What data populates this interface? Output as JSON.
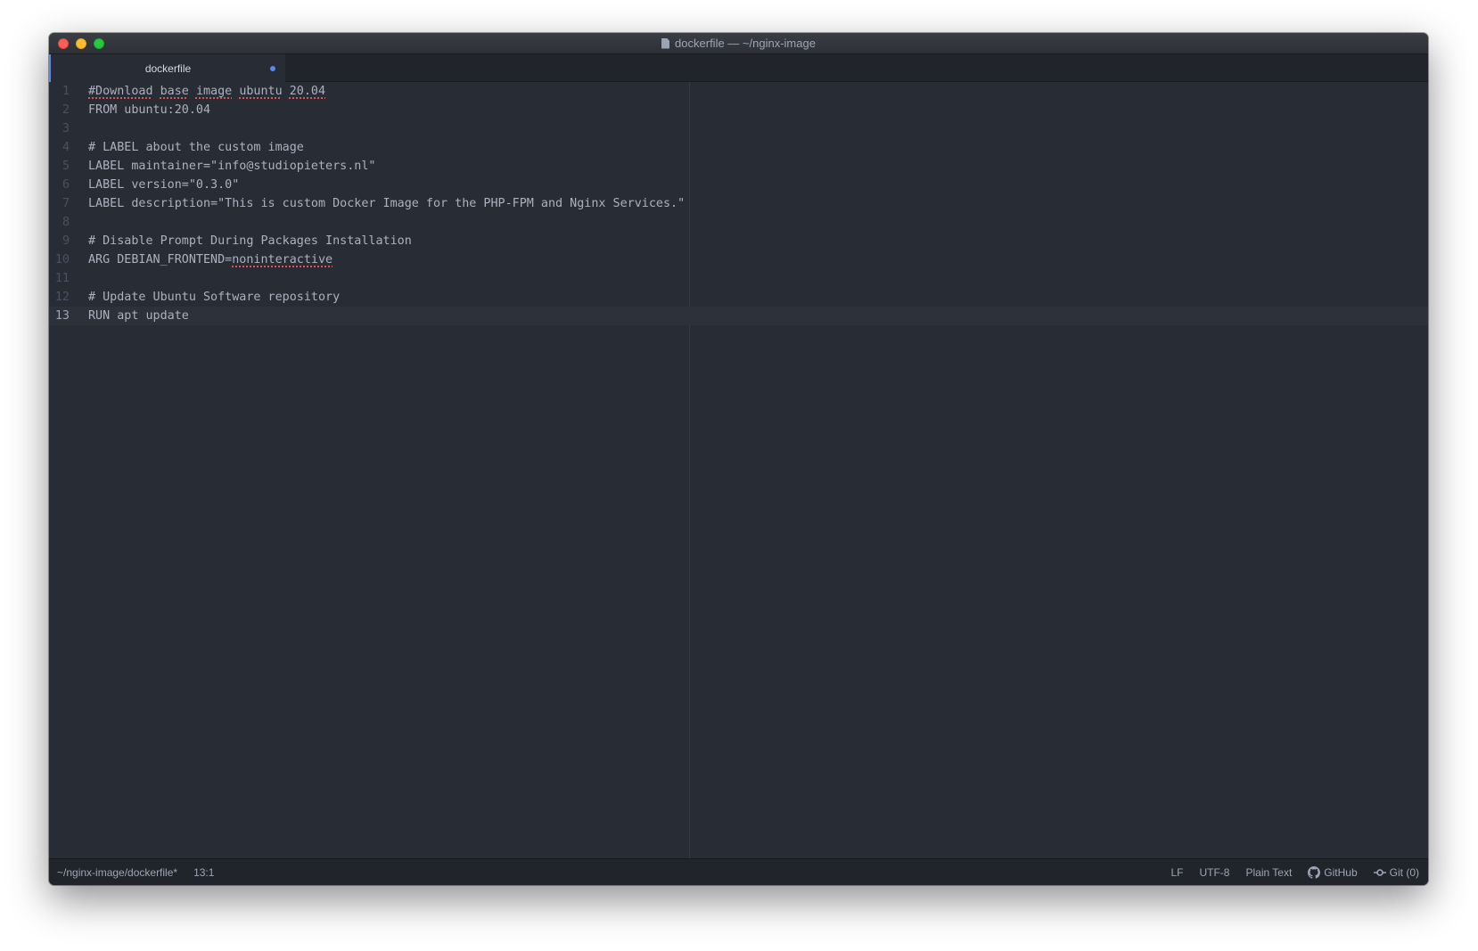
{
  "window": {
    "title": "dockerfile — ~/nginx-image"
  },
  "tab": {
    "title": "dockerfile",
    "modified": true
  },
  "editor": {
    "cursor_line": 13,
    "lines": [
      {
        "number": "1",
        "segments": [
          {
            "text": "#Download",
            "spell": true
          },
          {
            "text": " "
          },
          {
            "text": "base",
            "spell": true
          },
          {
            "text": " "
          },
          {
            "text": "image",
            "spell": true
          },
          {
            "text": " "
          },
          {
            "text": "ubuntu",
            "spell": true
          },
          {
            "text": " "
          },
          {
            "text": "20.04",
            "spell": true
          }
        ]
      },
      {
        "number": "2",
        "segments": [
          {
            "text": "FROM ubuntu:20.04"
          }
        ]
      },
      {
        "number": "3",
        "segments": []
      },
      {
        "number": "4",
        "segments": [
          {
            "text": "# LABEL about the custom image"
          }
        ]
      },
      {
        "number": "5",
        "segments": [
          {
            "text": "LABEL maintainer=\"info@studiopieters.nl\""
          }
        ]
      },
      {
        "number": "6",
        "segments": [
          {
            "text": "LABEL version=\"0.3.0\""
          }
        ]
      },
      {
        "number": "7",
        "segments": [
          {
            "text": "LABEL description=\"This is custom Docker Image for the PHP-FPM and Nginx Services.\""
          }
        ]
      },
      {
        "number": "8",
        "segments": []
      },
      {
        "number": "9",
        "segments": [
          {
            "text": "# Disable Prompt During Packages Installation"
          }
        ]
      },
      {
        "number": "10",
        "segments": [
          {
            "text": "ARG DEBIAN_FRONTEND="
          },
          {
            "text": "noninteractive",
            "spell": true
          }
        ]
      },
      {
        "number": "11",
        "segments": []
      },
      {
        "number": "12",
        "segments": [
          {
            "text": "# Update Ubuntu Software repository"
          }
        ]
      },
      {
        "number": "13",
        "segments": [
          {
            "text": "RUN apt update"
          }
        ]
      }
    ]
  },
  "statusbar": {
    "file_path": "~/nginx-image/dockerfile*",
    "cursor_position": "13:1",
    "line_ending": "LF",
    "encoding": "UTF-8",
    "grammar": "Plain Text",
    "github_label": "GitHub",
    "git_label": "Git (0)"
  },
  "colors": {
    "editor_bg": "#282c34",
    "accent": "#568af2",
    "spell_error": "#e05252"
  }
}
